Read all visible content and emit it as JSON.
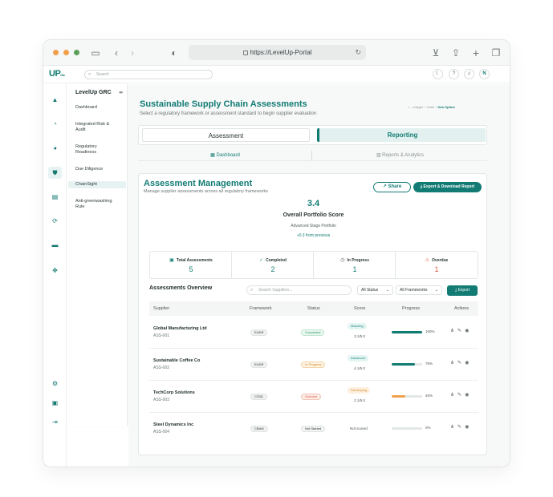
{
  "browser": {
    "url": "https://LevelUp-Portal",
    "colors": {
      "close": "#f0a04b",
      "minimize": "#f0a04b",
      "zoom": "#5aa05a"
    }
  },
  "topbar": {
    "logo": "UP",
    "logo_suffix": "Grc",
    "search_placeholder": "Search",
    "user_initial": "N",
    "help": "?"
  },
  "sidebar": {
    "title": "LevelUp GRC",
    "items": [
      {
        "label": "Dashboard"
      },
      {
        "label": "Integrated Risk & Audit"
      },
      {
        "label": "Regulatory Readiness"
      },
      {
        "label": "Due Diligence"
      },
      {
        "label": "ChainSight"
      },
      {
        "label": "Anti-greenwashing Rule"
      }
    ]
  },
  "header": {
    "title": "Sustainable Supply Chain Assessments",
    "subtitle": "Select a regulatory framework or assessment standard to begin supplier evaluation",
    "breadcrumb": [
      "Insight",
      "Child",
      "Sub Option"
    ]
  },
  "tabs": {
    "assessment": "Assessment",
    "reporting": "Reporting"
  },
  "subtabs": {
    "dashboard": "Dashboard",
    "reports": "Reports & Analytics"
  },
  "management": {
    "title": "Assessment Management",
    "subtitle": "Manage supplier assessments across all regulatory frameworks",
    "share_label": "Share",
    "export_report_label": "Export & Download Report",
    "score": "3.4",
    "score_label": "Overall Portfolio Score",
    "stage": "Advanced Stage Portfolio",
    "change": "+0.3 from previous"
  },
  "stats": [
    {
      "label": "Total Assessments",
      "value": "5",
      "icon": "clipboard-icon",
      "color": "#127c74"
    },
    {
      "label": "Completed",
      "value": "2",
      "icon": "check-circle-icon",
      "color": "#127c74"
    },
    {
      "label": "In Progress",
      "value": "1",
      "icon": "clock-icon",
      "color": "#127c74"
    },
    {
      "label": "Overdue",
      "value": "1",
      "icon": "warning-icon",
      "color": "#d65a3c"
    }
  ],
  "overview": {
    "title": "Assessments Overview",
    "search_placeholder": "Search Suppliers...",
    "status_filter": "All Status",
    "framework_filter": "All Frameworks",
    "export_label": "Export",
    "columns": [
      "Supplier",
      "Framework",
      "Status",
      "Score",
      "Progress",
      "Actions"
    ],
    "rows": [
      {
        "supplier": "Global Manufacturing Ltd",
        "id": "ASS-001",
        "framework": "EUDR",
        "status": "Completed",
        "score_level": "Maturing",
        "score": "3.1/5.0",
        "progress": 100,
        "progress_label": "100%",
        "bar_color": "#127c74"
      },
      {
        "supplier": "Sustainable Coffee Co",
        "id": "ASS-002",
        "framework": "EUDR",
        "status": "In Progress",
        "score_level": "Advanced",
        "score": "4.1/5.0",
        "progress": 75,
        "progress_label": "75%",
        "bar_color": "#127c74"
      },
      {
        "supplier": "TechCorp Solutions",
        "id": "ASS-003",
        "framework": "CS3D",
        "status": "Overdue",
        "score_level": "Developing",
        "score": "2.1/5.0",
        "progress": 45,
        "progress_label": "45%",
        "bar_color": "#f0a04b"
      },
      {
        "supplier": "Steel Dynamics Inc",
        "id": "ASS-004",
        "framework": "CBAM",
        "status": "Not Started",
        "score_level": "",
        "score": "Not scored",
        "progress": 0,
        "progress_label": "0%",
        "bar_color": "#127c74"
      }
    ]
  }
}
